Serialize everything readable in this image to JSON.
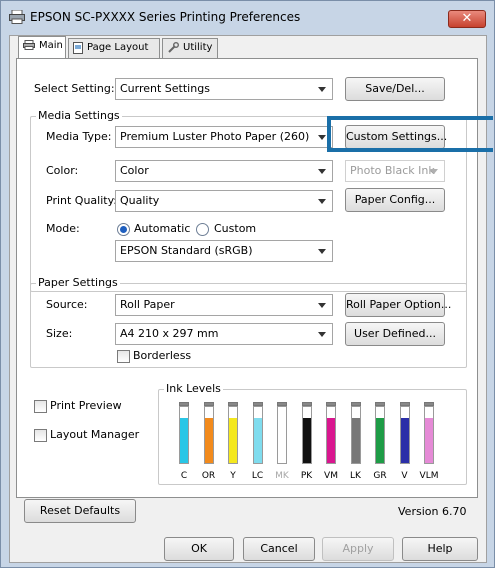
{
  "window": {
    "title": "EPSON SC-PXXXX Series Printing Preferences",
    "close": "✕"
  },
  "tabs": [
    {
      "label": "Main"
    },
    {
      "label": "Page Layout"
    },
    {
      "label": "Utility"
    }
  ],
  "select_setting": {
    "label": "Select Setting:",
    "value": "Current Settings",
    "button": "Save/Del..."
  },
  "media": {
    "group_title": "Media Settings",
    "media_type_label": "Media Type:",
    "media_type_value": "Premium Luster Photo Paper (260)",
    "custom_settings_button": "Custom Settings...",
    "color_label": "Color:",
    "color_value": "Color",
    "black_ink_value": "Photo Black Ink",
    "print_quality_label": "Print Quality:",
    "print_quality_value": "Quality",
    "paper_config_button": "Paper Config...",
    "mode_label": "Mode:",
    "mode_automatic": "Automatic",
    "mode_custom": "Custom",
    "mode_value": "EPSON Standard (sRGB)"
  },
  "paper": {
    "group_title": "Paper Settings",
    "source_label": "Source:",
    "source_value": "Roll Paper",
    "roll_option_button": "Roll Paper Option...",
    "size_label": "Size:",
    "size_value": "A4 210 x 297 mm",
    "user_defined_button": "User Defined...",
    "borderless_label": "Borderless"
  },
  "options": {
    "print_preview": "Print Preview",
    "layout_manager": "Layout Manager"
  },
  "ink_levels": {
    "title": "Ink Levels",
    "inks": [
      {
        "name": "C",
        "color": "#29c6e6",
        "level": 0.8,
        "muted": false
      },
      {
        "name": "OR",
        "color": "#f28a1c",
        "level": 0.8,
        "muted": false
      },
      {
        "name": "Y",
        "color": "#f4e81e",
        "level": 0.8,
        "muted": false
      },
      {
        "name": "LC",
        "color": "#7fdcee",
        "level": 0.8,
        "muted": false
      },
      {
        "name": "MK",
        "color": "#ffffff",
        "level": 0.0,
        "muted": true
      },
      {
        "name": "PK",
        "color": "#111111",
        "level": 0.8,
        "muted": false
      },
      {
        "name": "VM",
        "color": "#d9168f",
        "level": 0.8,
        "muted": false
      },
      {
        "name": "LK",
        "color": "#777777",
        "level": 0.8,
        "muted": false
      },
      {
        "name": "GR",
        "color": "#1e9c46",
        "level": 0.8,
        "muted": false
      },
      {
        "name": "V",
        "color": "#2b2fa8",
        "level": 0.8,
        "muted": false
      },
      {
        "name": "VLM",
        "color": "#e58ad6",
        "level": 0.8,
        "muted": false
      }
    ]
  },
  "footer": {
    "reset_defaults": "Reset Defaults",
    "version": "Version 6.70",
    "ok": "OK",
    "cancel": "Cancel",
    "apply": "Apply",
    "help": "Help"
  }
}
